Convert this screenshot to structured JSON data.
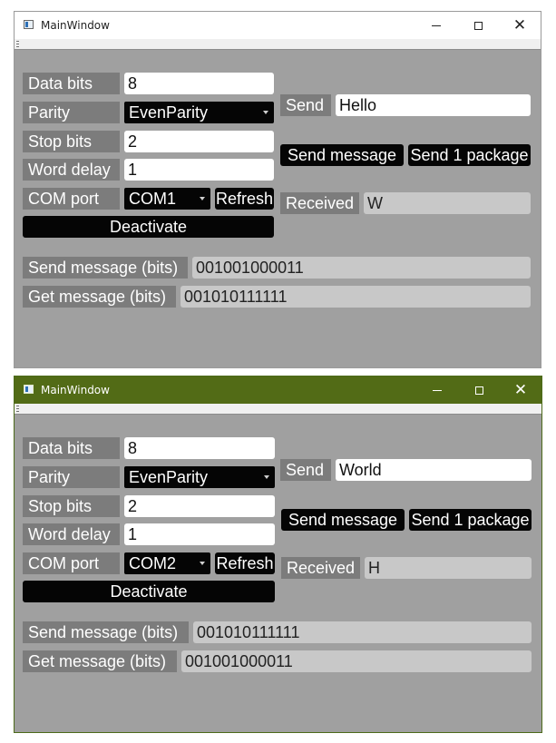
{
  "windows": [
    {
      "title": "MainWindow",
      "labels": {
        "data_bits": "Data bits",
        "parity": "Parity",
        "stop_bits": "Stop bits",
        "word_delay": "Word delay",
        "com_port": "COM port",
        "send": "Send",
        "received": "Received",
        "send_message_bits": "Send message (bits)",
        "get_message_bits": "Get message (bits)"
      },
      "values": {
        "data_bits": "8",
        "parity": "EvenParity",
        "stop_bits": "2",
        "word_delay": "1",
        "com_port": "COM1",
        "send": "Hello",
        "received": "W",
        "send_message_bits": "001001000011",
        "get_message_bits": "001010111111"
      },
      "buttons": {
        "refresh": "Refresh",
        "deactivate": "Deactivate",
        "send_message": "Send message",
        "send_package": "Send 1 package"
      },
      "active": false
    },
    {
      "title": "MainWindow",
      "labels": {
        "data_bits": "Data bits",
        "parity": "Parity",
        "stop_bits": "Stop bits",
        "word_delay": "Word delay",
        "com_port": "COM port",
        "send": "Send",
        "received": "Received",
        "send_message_bits": "Send message (bits)",
        "get_message_bits": "Get message (bits)"
      },
      "values": {
        "data_bits": "8",
        "parity": "EvenParity",
        "stop_bits": "2",
        "word_delay": "1",
        "com_port": "COM2",
        "send": "World",
        "received": "H",
        "send_message_bits": "001010111111",
        "get_message_bits": "001001000011"
      },
      "buttons": {
        "refresh": "Refresh",
        "deactivate": "Deactivate",
        "send_message": "Send message",
        "send_package": "Send 1 package"
      },
      "active": true
    }
  ],
  "colors": {
    "active_titlebar": "#526b16",
    "inactive_titlebar": "#ffffff",
    "client_background": "#a0a0a0"
  },
  "icons": {
    "window": "app-window-icon",
    "minimize": "minimize-icon",
    "maximize": "maximize-icon",
    "close": "close-icon",
    "toolbar": "toolbar-grip-icon",
    "combo": "chevron-down-icon"
  }
}
